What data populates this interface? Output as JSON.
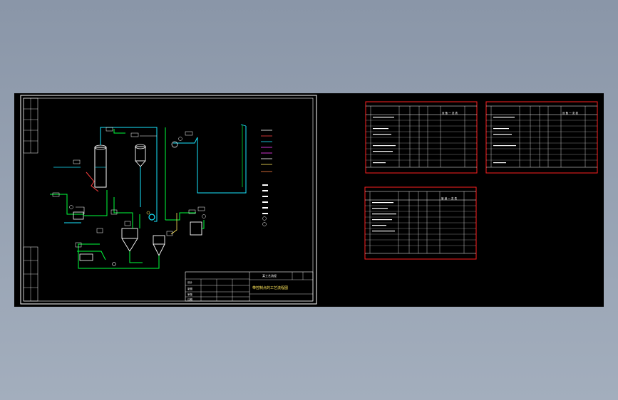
{
  "title_block": {
    "drawing_title": "带控制点的工艺流程图",
    "label_top": "某工艺流程",
    "rows": [
      "设计",
      "制图",
      "审核",
      "日期"
    ]
  },
  "tables": [
    {
      "name": "equipment-table-1",
      "header": "设 备 一 览 表"
    },
    {
      "name": "equipment-table-2",
      "header": "设 备 一 览 表"
    },
    {
      "name": "equipment-table-3",
      "header": "管 道 一 览 表"
    }
  ],
  "colors": {
    "background": "#000000",
    "frame": "#ffffff",
    "pipe_green": "#00ff3c",
    "pipe_cyan": "#19e6ff",
    "table_border": "#ff2020",
    "vessel_white": "#ffffff"
  }
}
